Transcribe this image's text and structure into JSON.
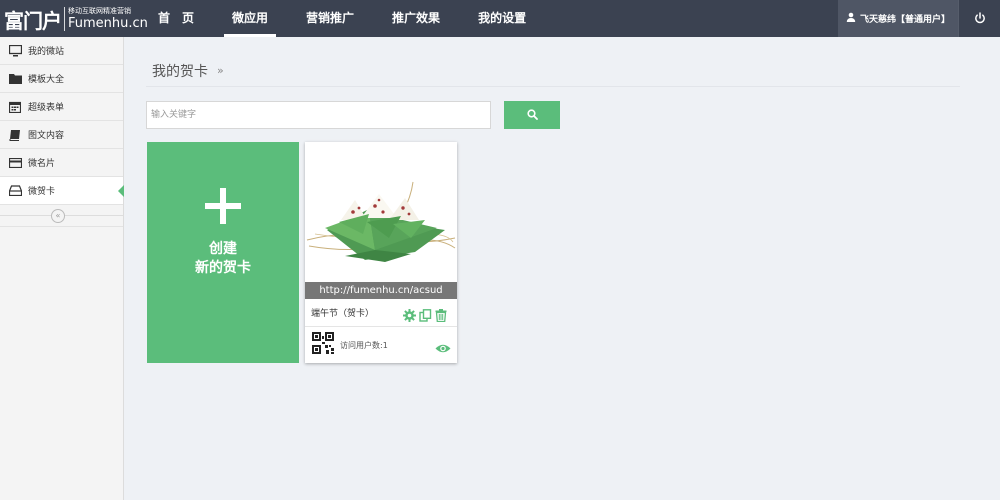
{
  "brand": {
    "logo_text": "富门户",
    "slogan": "移动互联网精准营销",
    "domain": "Fumenhu.cn"
  },
  "nav": {
    "items": [
      {
        "label": "首　页",
        "active": false
      },
      {
        "label": "微应用",
        "active": true
      },
      {
        "label": "营销推广",
        "active": false
      },
      {
        "label": "推广效果",
        "active": false
      },
      {
        "label": "我的设置",
        "active": false
      }
    ]
  },
  "user": {
    "name": "飞天慈纬【普通用户】",
    "icon": "user-icon",
    "logout_icon": "power-icon"
  },
  "sidebar": {
    "items": [
      {
        "label": "我的微站",
        "icon": "monitor-icon",
        "active": false
      },
      {
        "label": "模板大全",
        "icon": "folder-icon",
        "active": false
      },
      {
        "label": "超级表单",
        "icon": "calendar-icon",
        "active": false
      },
      {
        "label": "图文内容",
        "icon": "book-icon",
        "active": false
      },
      {
        "label": "微名片",
        "icon": "card-icon",
        "active": false
      },
      {
        "label": "微贺卡",
        "icon": "inbox-icon",
        "active": true
      }
    ],
    "collapse_label": "«"
  },
  "main": {
    "title": "我的贺卡",
    "breadcrumb_arrow": "»",
    "search": {
      "placeholder": "输入关键字",
      "value": ""
    },
    "create": {
      "line1": "创建",
      "line2": "新的贺卡"
    },
    "cards": [
      {
        "url": "http://fumenhu.cn/acsud",
        "name": "端午节（贺卡）",
        "visits_label": "访问用户数:1"
      }
    ]
  },
  "colors": {
    "topbar": "#3b4251",
    "accent": "#5bbd7b",
    "background": "#eef1f5"
  }
}
